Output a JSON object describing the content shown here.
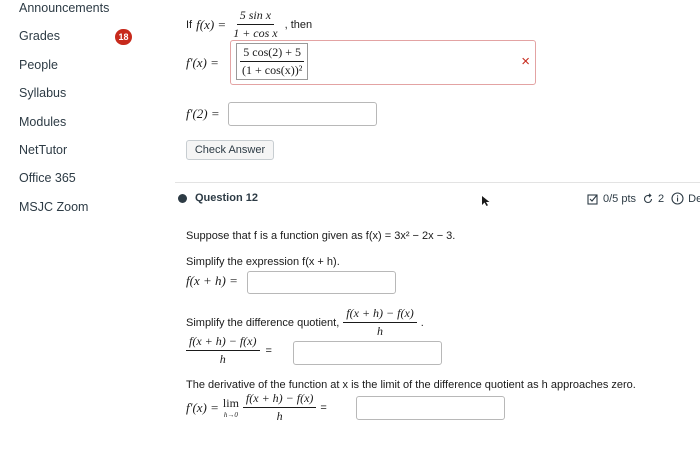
{
  "nav": {
    "items": [
      "Announcements",
      "Grades",
      "People",
      "Syllabus",
      "Modules",
      "NetTutor",
      "Office 365",
      "MSJC Zoom"
    ],
    "grades_badge": "18"
  },
  "q11": {
    "if_text": "If",
    "f_x": "f(x) =",
    "frac_num": "5 sin x",
    "frac_den": "1 + cos x",
    "then_text": ", then",
    "fprime_label": "f′(x) =",
    "entered_num": "5 cos(2) + 5",
    "entered_den": "(1 + cos(x))²",
    "wrong_mark": "×",
    "fprime2_label": "f′(2) =",
    "check_button": "Check Answer"
  },
  "q12": {
    "title": "Question 12",
    "score": "0/5 pts",
    "retries": "2",
    "details_partial": "De",
    "intro": "Suppose that f is a function given as f(x) = 3x² − 2x − 3.",
    "simplify_expr_label": "Simplify the expression f(x + h).",
    "fxh_label": "f(x + h) =",
    "simplify_dq_label": "Simplify the difference quotient,",
    "dq_num": "f(x + h) − f(x)",
    "dq_den": "h",
    "period": ".",
    "eq": "=",
    "derivative_text": "The derivative of the function at x is the limit of the difference quotient as h approaches zero.",
    "fprime_x": "f′(x) =",
    "lim": "lim",
    "lim_sub": "h→0"
  }
}
